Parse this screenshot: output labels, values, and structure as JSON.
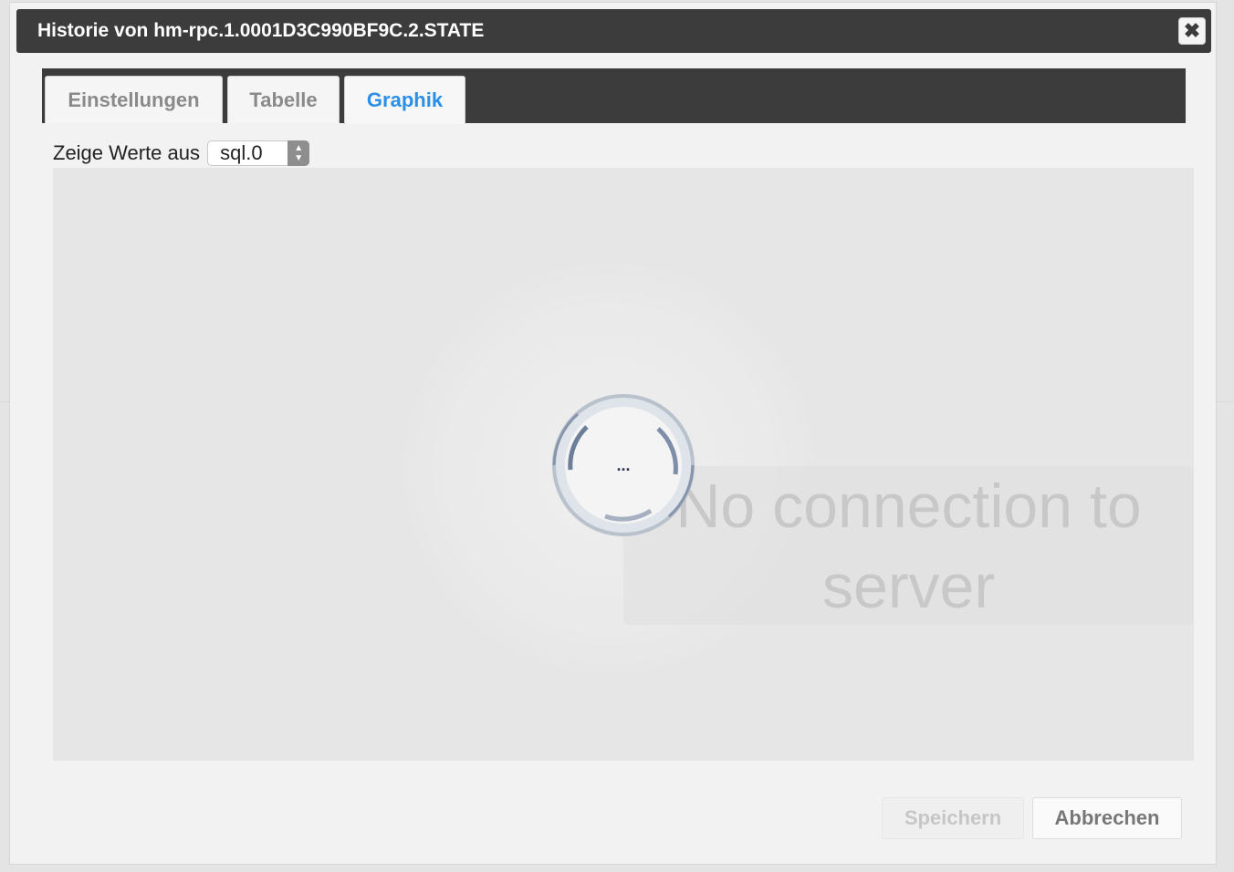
{
  "dialog": {
    "title": "Historie von hm-rpc.1.0001D3C990BF9C.2.STATE",
    "close_icon": "close-icon"
  },
  "tabs": [
    {
      "label": "Einstellungen",
      "active": false
    },
    {
      "label": "Tabelle",
      "active": false
    },
    {
      "label": "Graphik",
      "active": true
    }
  ],
  "graph": {
    "show_values_label": "Zeige Werte aus",
    "instance_select": {
      "value": "sql.0"
    },
    "loading_text": "...",
    "overlay_message": "No connection to server"
  },
  "buttons": {
    "save_label": "Speichern",
    "cancel_label": "Abbrechen"
  },
  "colors": {
    "titlebar": "#3c3c3c",
    "active_tab": "#2b8fe6",
    "chart_bg": "#e6e6e6"
  }
}
